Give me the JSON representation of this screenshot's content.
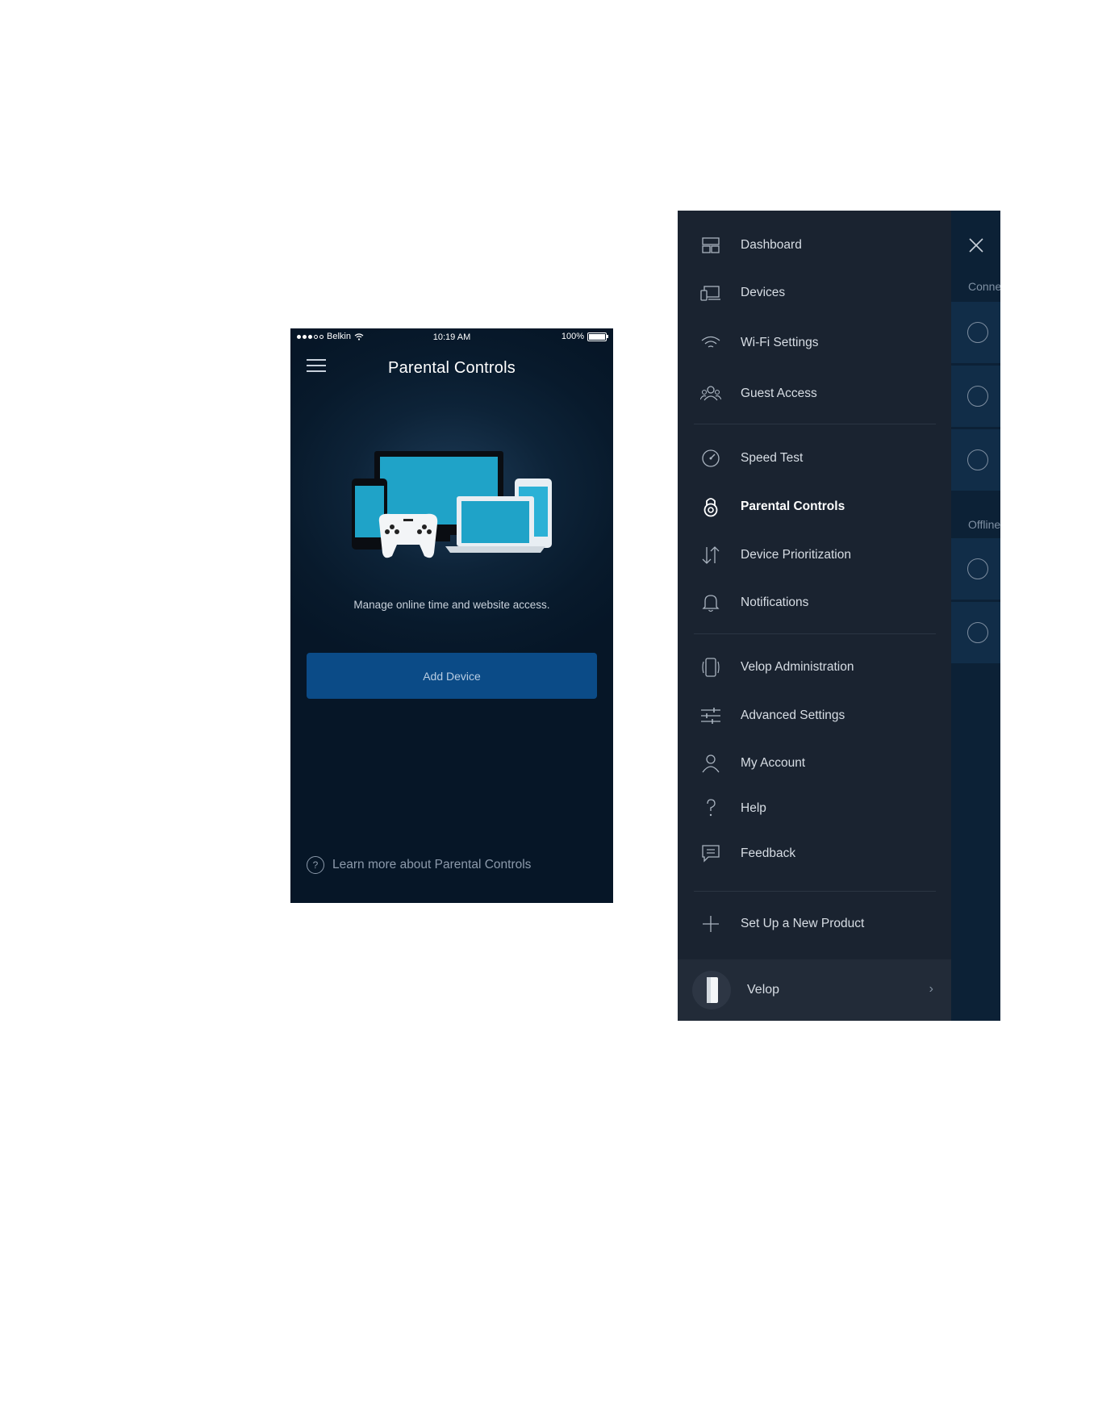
{
  "phone": {
    "status": {
      "carrier": "Belkin",
      "time": "10:19 AM",
      "battery": "100%"
    },
    "title": "Parental Controls",
    "tagline": "Manage online time and website access.",
    "add_device_label": "Add Device",
    "learn_more": "Learn more about Parental Controls",
    "help_glyph": "?"
  },
  "nav": {
    "items": [
      {
        "label": "Dashboard",
        "icon": "dashboard-icon"
      },
      {
        "label": "Devices",
        "icon": "devices-icon"
      },
      {
        "label": "Wi-Fi Settings",
        "icon": "wifi-icon"
      },
      {
        "label": "Guest Access",
        "icon": "guest-icon"
      },
      {
        "label": "Speed Test",
        "icon": "speedometer-icon"
      },
      {
        "label": "Parental Controls",
        "icon": "lock-icon",
        "active": true
      },
      {
        "label": "Device Prioritization",
        "icon": "priority-arrows-icon"
      },
      {
        "label": "Notifications",
        "icon": "bell-icon"
      },
      {
        "label": "Velop Administration",
        "icon": "node-icon"
      },
      {
        "label": "Advanced Settings",
        "icon": "sliders-icon"
      },
      {
        "label": "My Account",
        "icon": "user-icon"
      },
      {
        "label": "Help",
        "icon": "question-icon"
      },
      {
        "label": "Feedback",
        "icon": "chat-icon"
      },
      {
        "label": "Set Up a New Product",
        "icon": "plus-icon"
      }
    ],
    "product": {
      "label": "Velop",
      "chevron": "›"
    },
    "underlay": {
      "connected_label": "Conne",
      "offline_label": "Offline"
    }
  },
  "colors": {
    "phone_bg": "#081a2c",
    "add_device_button": "#0b4b87",
    "drawer_bg": "#1a2330",
    "underlay_bg": "#0c2136"
  }
}
